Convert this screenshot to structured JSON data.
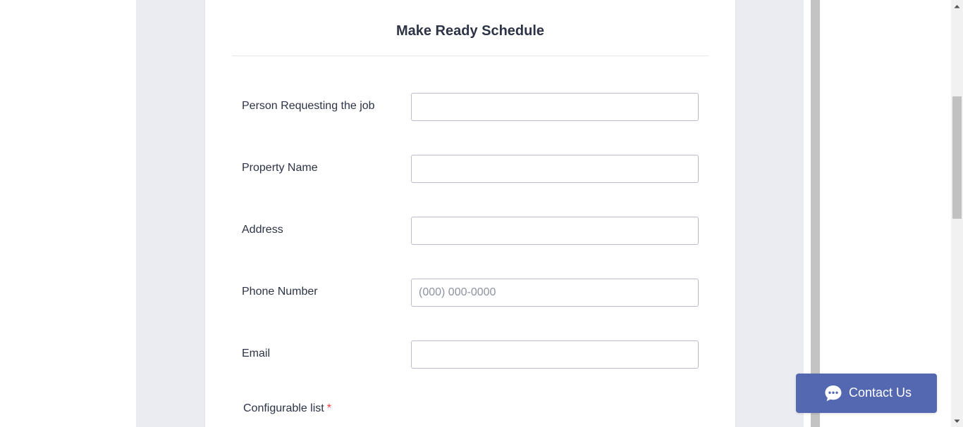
{
  "form": {
    "title": "Make Ready Schedule",
    "fields": [
      {
        "label": "Person Requesting the job",
        "value": "",
        "placeholder": ""
      },
      {
        "label": "Property Name",
        "value": "",
        "placeholder": ""
      },
      {
        "label": "Address",
        "value": "",
        "placeholder": ""
      },
      {
        "label": "Phone Number",
        "value": "",
        "placeholder": "(000) 000-0000"
      },
      {
        "label": "Email",
        "value": "",
        "placeholder": ""
      }
    ],
    "list_label": "Configurable list",
    "required_mark": "*"
  },
  "contact_widget": {
    "label": "Contact Us",
    "icon": "chat-bubble-icon",
    "color": "#5468b2"
  },
  "colors": {
    "backdrop": "#ebecf1",
    "text": "#2c3345",
    "required": "#f23a3c"
  }
}
